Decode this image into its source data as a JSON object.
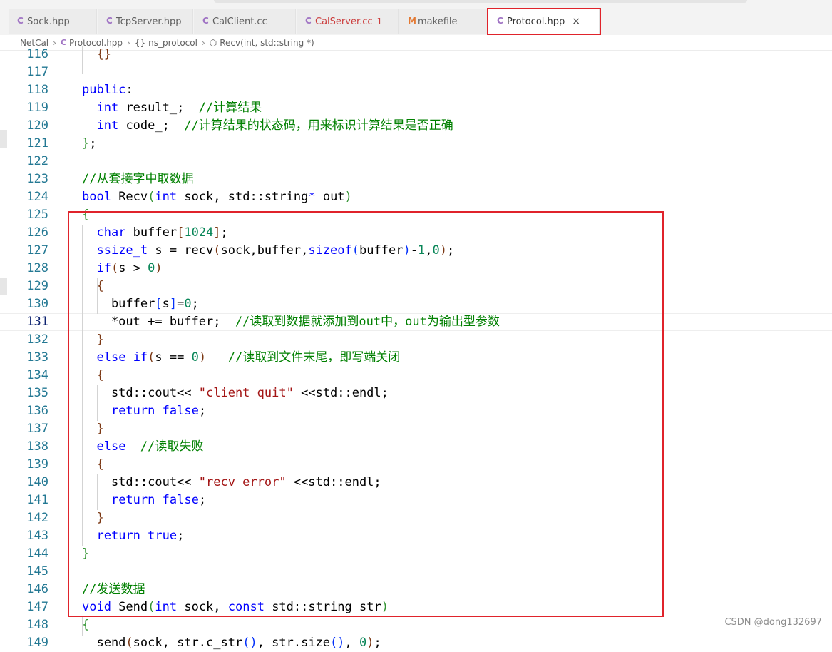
{
  "tabs": [
    {
      "icon": "C",
      "label": "Sock.hpp",
      "active": false
    },
    {
      "icon": "C",
      "label": "TcpServer.hpp",
      "active": false
    },
    {
      "icon": "C",
      "label": "CalClient.cc",
      "active": false
    },
    {
      "icon": "C",
      "label": "CalServer.cc",
      "badge": "1",
      "active": false
    },
    {
      "icon": "M",
      "label": "makefile",
      "active": false
    },
    {
      "icon": "C",
      "label": "Protocol.hpp",
      "close": "×",
      "active": true
    }
  ],
  "breadcrumb": {
    "root": "NetCal",
    "file": "Protocol.hpp",
    "namespace": "ns_protocol",
    "symbol": "Recv(int, std::string *)"
  },
  "colors": {
    "highlight_border": "#e0232b",
    "line_number": "#237893",
    "keyword": "#0000ff",
    "comment": "#008000",
    "string": "#a31515",
    "number": "#098658"
  },
  "current_line": 131,
  "lines": [
    {
      "num": "116",
      "tokens": [
        [
          "p3",
          "  {}"
        ]
      ]
    },
    {
      "num": "117",
      "tokens": []
    },
    {
      "num": "118",
      "tokens": [
        [
          "k",
          "public"
        ],
        [
          "",
          ":"
        ]
      ]
    },
    {
      "num": "119",
      "tokens": [
        [
          "",
          "  "
        ],
        [
          "k",
          "int"
        ],
        [
          "",
          " result_;  "
        ],
        [
          "c",
          "//计算结果"
        ]
      ]
    },
    {
      "num": "120",
      "tokens": [
        [
          "",
          "  "
        ],
        [
          "k",
          "int"
        ],
        [
          "",
          " code_;  "
        ],
        [
          "c",
          "//计算结果的状态码，用来标识计算结果是否正确"
        ]
      ]
    },
    {
      "num": "121",
      "tokens": [
        [
          "p2",
          "}"
        ],
        [
          "",
          ";"
        ]
      ]
    },
    {
      "num": "122",
      "tokens": []
    },
    {
      "num": "123",
      "tokens": [
        [
          "c",
          "//从套接字中取数据"
        ]
      ]
    },
    {
      "num": "124",
      "tokens": [
        [
          "k",
          "bool"
        ],
        [
          "",
          " Recv"
        ],
        [
          "p2",
          "("
        ],
        [
          "k",
          "int"
        ],
        [
          "",
          " sock, std::string"
        ],
        [
          "k",
          "*"
        ],
        [
          "",
          " out"
        ],
        [
          "p2",
          ")"
        ]
      ]
    },
    {
      "num": "125",
      "tokens": [
        [
          "p2",
          "{"
        ]
      ]
    },
    {
      "num": "126",
      "tokens": [
        [
          "",
          "  "
        ],
        [
          "k",
          "char"
        ],
        [
          "",
          " buffer"
        ],
        [
          "p3",
          "["
        ],
        [
          "n",
          "1024"
        ],
        [
          "p3",
          "]"
        ],
        [
          "",
          ";"
        ]
      ]
    },
    {
      "num": "127",
      "tokens": [
        [
          "",
          "  "
        ],
        [
          "k",
          "ssize_t"
        ],
        [
          "",
          " s = recv"
        ],
        [
          "p3",
          "("
        ],
        [
          "",
          "sock,buffer,"
        ],
        [
          "k",
          "sizeof"
        ],
        [
          "p1",
          "("
        ],
        [
          "",
          "buffer"
        ],
        [
          "p1",
          ")"
        ],
        [
          "",
          "-"
        ],
        [
          "n",
          "1"
        ],
        [
          "",
          ","
        ],
        [
          "n",
          "0"
        ],
        [
          "p3",
          ")"
        ],
        [
          "",
          ";"
        ]
      ]
    },
    {
      "num": "128",
      "tokens": [
        [
          "",
          "  "
        ],
        [
          "k",
          "if"
        ],
        [
          "p3",
          "("
        ],
        [
          "",
          "s > "
        ],
        [
          "n",
          "0"
        ],
        [
          "p3",
          ")"
        ]
      ]
    },
    {
      "num": "129",
      "tokens": [
        [
          "",
          "  "
        ],
        [
          "p3",
          "{"
        ]
      ]
    },
    {
      "num": "130",
      "tokens": [
        [
          "",
          "    buffer"
        ],
        [
          "p1",
          "["
        ],
        [
          "",
          "s"
        ],
        [
          "p1",
          "]"
        ],
        [
          "",
          "="
        ],
        [
          "n",
          "0"
        ],
        [
          "",
          ";"
        ]
      ]
    },
    {
      "num": "131",
      "tokens": [
        [
          "",
          "    *out += buffer;  "
        ],
        [
          "c",
          "//读取到数据就添加到out中，out为输出型参数"
        ]
      ]
    },
    {
      "num": "132",
      "tokens": [
        [
          "",
          "  "
        ],
        [
          "p3",
          "}"
        ]
      ]
    },
    {
      "num": "133",
      "tokens": [
        [
          "",
          "  "
        ],
        [
          "k",
          "else"
        ],
        [
          "",
          " "
        ],
        [
          "k",
          "if"
        ],
        [
          "p3",
          "("
        ],
        [
          "",
          "s == "
        ],
        [
          "n",
          "0"
        ],
        [
          "p3",
          ")"
        ],
        [
          "",
          "   "
        ],
        [
          "c",
          "//读取到文件末尾，即写端关闭"
        ]
      ]
    },
    {
      "num": "134",
      "tokens": [
        [
          "",
          "  "
        ],
        [
          "p3",
          "{"
        ]
      ]
    },
    {
      "num": "135",
      "tokens": [
        [
          "",
          "    std::cout<< "
        ],
        [
          "s",
          "\"client quit\""
        ],
        [
          "",
          " <<std::endl;"
        ]
      ]
    },
    {
      "num": "136",
      "tokens": [
        [
          "",
          "    "
        ],
        [
          "k",
          "return"
        ],
        [
          "",
          " "
        ],
        [
          "k",
          "false"
        ],
        [
          "",
          ";"
        ]
      ]
    },
    {
      "num": "137",
      "tokens": [
        [
          "",
          "  "
        ],
        [
          "p3",
          "}"
        ]
      ]
    },
    {
      "num": "138",
      "tokens": [
        [
          "",
          "  "
        ],
        [
          "k",
          "else"
        ],
        [
          "",
          "  "
        ],
        [
          "c",
          "//读取失败"
        ]
      ]
    },
    {
      "num": "139",
      "tokens": [
        [
          "",
          "  "
        ],
        [
          "p3",
          "{"
        ]
      ]
    },
    {
      "num": "140",
      "tokens": [
        [
          "",
          "    std::cout<< "
        ],
        [
          "s",
          "\"recv error\""
        ],
        [
          "",
          " <<std::endl;"
        ]
      ]
    },
    {
      "num": "141",
      "tokens": [
        [
          "",
          "    "
        ],
        [
          "k",
          "return"
        ],
        [
          "",
          " "
        ],
        [
          "k",
          "false"
        ],
        [
          "",
          ";"
        ]
      ]
    },
    {
      "num": "142",
      "tokens": [
        [
          "",
          "  "
        ],
        [
          "p3",
          "}"
        ]
      ]
    },
    {
      "num": "143",
      "tokens": [
        [
          "",
          "  "
        ],
        [
          "k",
          "return"
        ],
        [
          "",
          " "
        ],
        [
          "k",
          "true"
        ],
        [
          "",
          ";"
        ]
      ]
    },
    {
      "num": "144",
      "tokens": [
        [
          "p2",
          "}"
        ]
      ]
    },
    {
      "num": "145",
      "tokens": []
    },
    {
      "num": "146",
      "tokens": [
        [
          "c",
          "//发送数据"
        ]
      ]
    },
    {
      "num": "147",
      "tokens": [
        [
          "k",
          "void"
        ],
        [
          "",
          " Send"
        ],
        [
          "p2",
          "("
        ],
        [
          "k",
          "int"
        ],
        [
          "",
          " sock, "
        ],
        [
          "k",
          "const"
        ],
        [
          "",
          " std::string str"
        ],
        [
          "p2",
          ")"
        ]
      ]
    },
    {
      "num": "148",
      "tokens": [
        [
          "p2",
          "{"
        ]
      ]
    },
    {
      "num": "149",
      "tokens": [
        [
          "",
          "  send"
        ],
        [
          "p3",
          "("
        ],
        [
          "",
          "sock, str.c_str"
        ],
        [
          "p1",
          "()"
        ],
        [
          "",
          ", str.size"
        ],
        [
          "p1",
          "()"
        ],
        [
          "",
          ", "
        ],
        [
          "n",
          "0"
        ],
        [
          "p3",
          ")"
        ],
        [
          "",
          ";"
        ]
      ]
    }
  ],
  "watermark": "CSDN @dong132697"
}
